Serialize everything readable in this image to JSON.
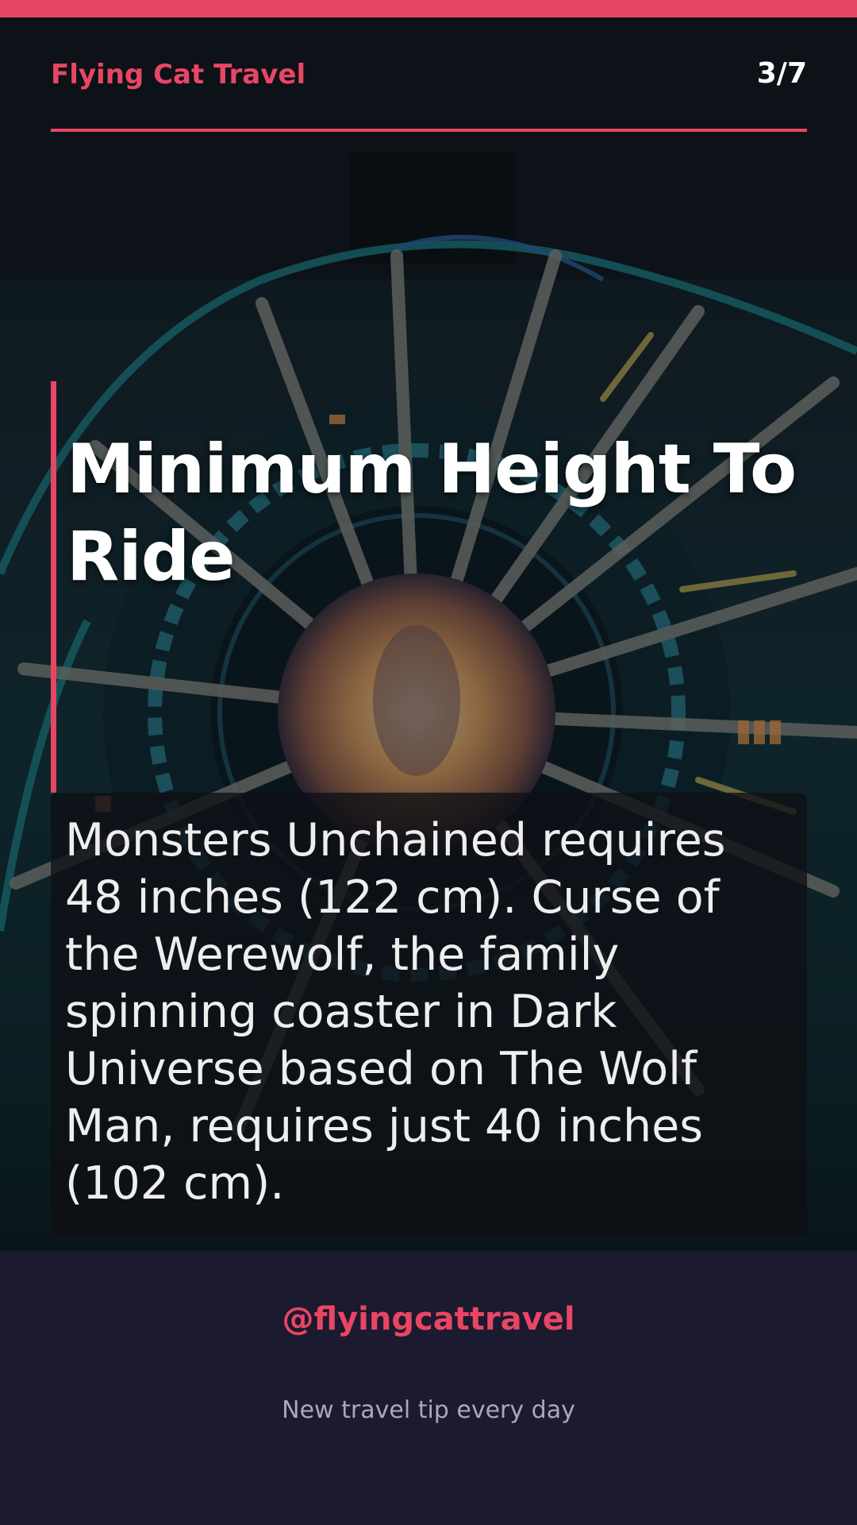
{
  "header": {
    "brand": "Flying Cat Travel",
    "slide_counter": "3/7"
  },
  "slide": {
    "headline": "Minimum Height To Ride",
    "body": "Monsters Unchained requires 48 inches (122 cm). Curse of the Werewolf, the family spinning coaster in Dark Universe based on The Wolf Man, requires just 40 inches (102 cm)."
  },
  "footer": {
    "handle": "@flyingcattravel",
    "tagline": "New travel tip every day"
  },
  "colors": {
    "accent": "#e84664",
    "footer_background": "#1b1a2e",
    "text": "#ffffff"
  }
}
